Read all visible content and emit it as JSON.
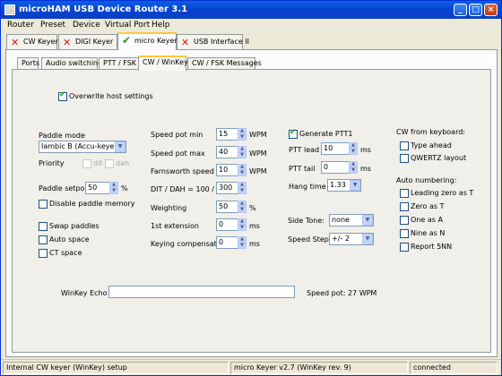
{
  "window": {
    "title": "microHAM USB Device Router 3.1"
  },
  "menu": [
    "Router",
    "Preset",
    "Device",
    "Virtual Port",
    "Help"
  ],
  "main_tabs": [
    "CW Keyer",
    "DIGI Keyer",
    "micro Keyer",
    "USB Interface II"
  ],
  "sub_tabs": [
    "Ports",
    "Audio switching",
    "PTT / FSK",
    "CW / WinKey",
    "CW / FSK Messages"
  ],
  "overwrite_host": "Overwrite host settings",
  "paddle": {
    "mode_label": "Paddle mode",
    "mode_value": "Iambic B  (Accu-keyer)",
    "priority_label": "Priority",
    "dit": "dit",
    "dah": "dah",
    "setpoint_label": "Paddle setpoint",
    "setpoint_value": "50",
    "setpoint_unit": "%",
    "disable_memory": "Disable paddle memory",
    "swap": "Swap paddles",
    "autospace": "Auto space",
    "ctspace": "CT space"
  },
  "speed": {
    "pot_min_label": "Speed pot min",
    "pot_min": "15",
    "pot_max_label": "Speed pot max",
    "pot_max": "40",
    "farnsworth_label": "Farnsworth speed",
    "farnsworth": "10",
    "ditdah_label": "DIT / DAH = 100 /",
    "ditdah": "300",
    "weighting_label": "Weighting",
    "weighting": "50",
    "first_ext_label": "1st extension",
    "first_ext": "0",
    "keycomp_label": "Keying compensation",
    "keycomp": "0",
    "wpm": "WPM",
    "pct": "%",
    "ms": "ms"
  },
  "ptt": {
    "generate": "Generate PTT1",
    "lead_label": "PTT lead",
    "lead": "10",
    "tail_label": "PTT tail",
    "tail": "0",
    "hang_label": "Hang time",
    "hang": "1.33",
    "ms": "ms"
  },
  "sidetone": {
    "label": "Side Tone:",
    "value": "none"
  },
  "speedstep": {
    "label": "Speed Step:",
    "value": "+/- 2"
  },
  "keyboard": {
    "title": "CW from keyboard:",
    "type_ahead": "Type ahead",
    "qwertz": "QWERTZ layout"
  },
  "autonum": {
    "title": "Auto numbering:",
    "lead_zero": "Leading zero as T",
    "zero_t": "Zero as T",
    "one_a": "One as A",
    "nine_n": "Nine as N",
    "report": "Report 5NN"
  },
  "echo": {
    "label": "WinKey Echo",
    "value": "",
    "speed_pot": "Speed pot: 27 WPM"
  },
  "status": {
    "left": "Internal CW keyer (WinKey) setup",
    "mid": "micro Keyer v2.7 (WinKey rev. 9)",
    "right": "connected"
  }
}
